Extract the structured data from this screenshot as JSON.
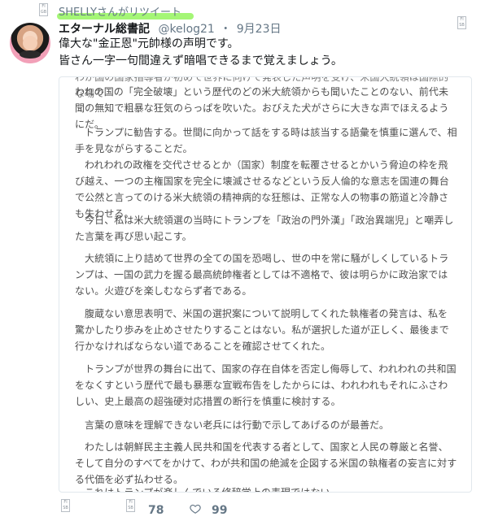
{
  "retweet": {
    "label": "SHELLYさんがリツイート"
  },
  "tweet": {
    "display_name": "エターナル総書記",
    "handle": "@kelog21",
    "separator": "・",
    "date": "9月23日",
    "text_line1": "偉大な\"金正恩\"元帥様の声明です。",
    "text_line2": "皆さん一字一句間違えず暗唱できるまで覚えましょう。",
    "reply_count": "78",
    "like_count": "99"
  },
  "document": {
    "line_top_cut": "わが国の国家指導者が初めて世界に向けて発表した声明を受け、米国大統領は国際的な場で",
    "para1": "われの国の「完全破壊」という歴代のどの米大統領からも聞いたことのない、前代未聞の無知で粗暴な狂気のらっぱを吹いた。おびえた犬がさらに大きな声でほえるようにだ。",
    "para2": "トランプに勧告する。世間に向かって話をする時は該当する語彙を慎重に選んで、相手を見ながらすることだ。",
    "para3": "われわれの政権を交代させるとか（国家）制度を転覆させるとかいう脅迫の枠を飛び越え、一つの主権国家を完全に壊滅させるなどという反人倫的な意志を国連の舞台で公然と言ってのける米大統領の精神病的な狂態は、正常な人の物事の筋道と冷静さも失わせる。",
    "para4": "今日、私は米大統領選の当時にトランプを「政治の門外漢」「政治異端児」と嘲弄した言葉を再び思い起こす。",
    "para5": "大統領に上り詰めて世界の全ての国を恐喝し、世の中を常に騒がしくしているトランプは、一国の武力を握る最高統帥権者としては不適格で、彼は明らかに政治家ではない。火遊びを楽しむならず者である。",
    "para6": "腹蔵ない意思表明で、米国の選択案について説明してくれた執権者の発言は、私を驚かしたり歩みを止めさせたりすることはない。私が選択した道が正しく、最後まで行かなければならない道であることを確認させてくれた。",
    "para7": "トランプが世界の舞台に出て、国家の存在自体を否定し侮辱して、われわれの共和国をなくすという歴代で最も暴悪な宣戦布告をしたからには、われわれもそれにふさわしい、史上最高の超強硬対応措置の断行を慎重に検討する。",
    "para8": "言葉の意味を理解できない老兵には行動で示してあげるのが最善だ。",
    "para9": "わたしは朝鮮民主主義人民共和国を代表する者として、国家と人民の尊厳と名誉、そして自分のすべてをかけて、わが共和国の絶滅を企図する米国の執権者の妄言に対する代価を必ず払わせる。",
    "para10_cut": "これはトランプが楽しんでいる修辞学上の表現ではない。"
  },
  "colors": {
    "highlight": "#9ff56f",
    "secondary_text": "#657786",
    "border": "#e1e8ed"
  },
  "icons": [
    "retweet-icon",
    "avatar-icon",
    "more-options-icon",
    "reply-icon",
    "retweet-action-icon",
    "heart-icon"
  ]
}
